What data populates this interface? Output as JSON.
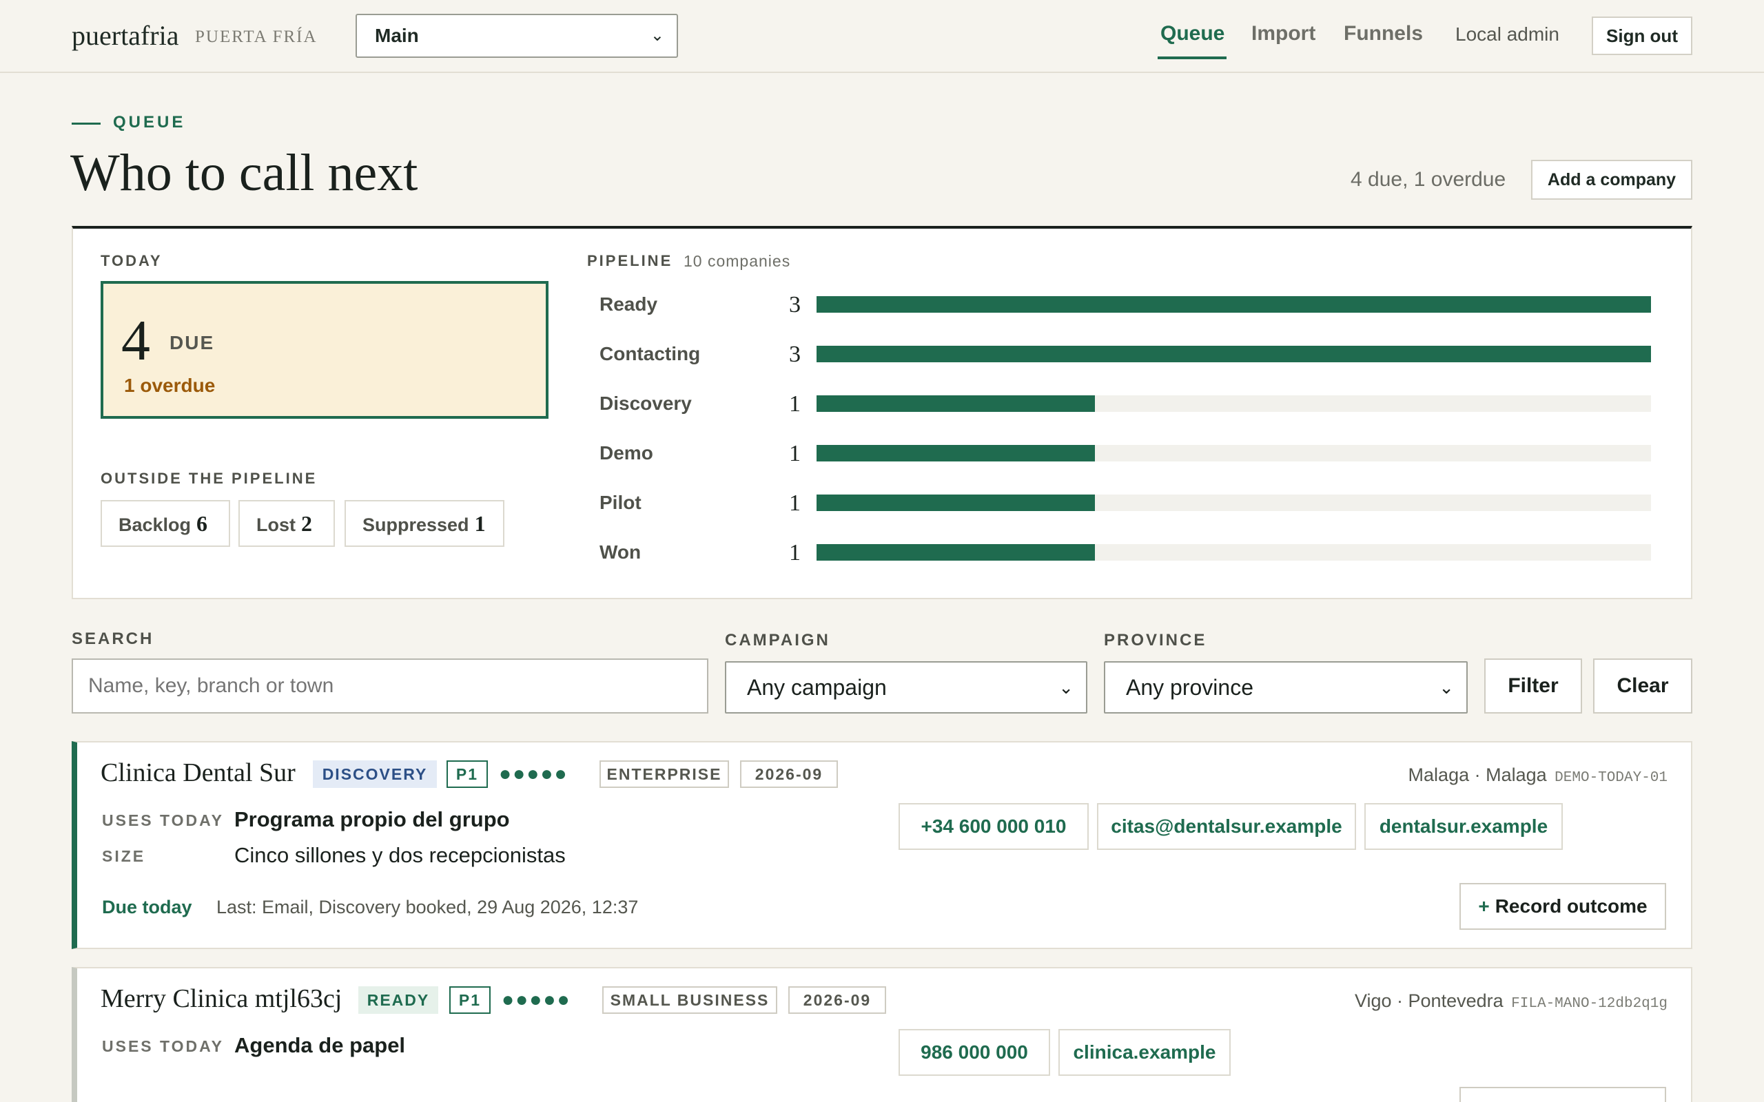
{
  "header": {
    "brand": "puertafria",
    "brand_sub": "PUERTA FRÍA",
    "workspace_select": "Main",
    "nav": [
      "Queue",
      "Import",
      "Funnels"
    ],
    "active_nav": "Queue",
    "user": "Local admin",
    "sign_out": "Sign out"
  },
  "page": {
    "eyebrow": "QUEUE",
    "title": "Who to call next",
    "summary": "4 due, 1 overdue",
    "add_button": "Add a company"
  },
  "today": {
    "label": "TODAY",
    "due_count": "4",
    "due_label": "DUE",
    "overdue": "1 overdue"
  },
  "outside": {
    "label": "OUTSIDE THE PIPELINE",
    "chips": [
      {
        "label": "Backlog",
        "count": "6"
      },
      {
        "label": "Lost",
        "count": "2"
      },
      {
        "label": "Suppressed",
        "count": "1"
      }
    ]
  },
  "pipeline": {
    "label": "PIPELINE",
    "count": "10 companies",
    "max": 3,
    "stages": [
      {
        "name": "Ready",
        "count": "3",
        "value": 3
      },
      {
        "name": "Contacting",
        "count": "3",
        "value": 3
      },
      {
        "name": "Discovery",
        "count": "1",
        "value": 1
      },
      {
        "name": "Demo",
        "count": "1",
        "value": 1
      },
      {
        "name": "Pilot",
        "count": "1",
        "value": 1
      },
      {
        "name": "Won",
        "count": "1",
        "value": 1
      }
    ]
  },
  "filters": {
    "search_label": "SEARCH",
    "search_placeholder": "Name, key, branch or town",
    "campaign_label": "CAMPAIGN",
    "campaign_value": "Any campaign",
    "province_label": "PROVINCE",
    "province_value": "Any province",
    "filter_button": "Filter",
    "clear_button": "Clear"
  },
  "companies": [
    {
      "name": "Clinica Dental Sur",
      "stage": "DISCOVERY",
      "priority": "P1",
      "score_dots": "●●●●●",
      "segment": "ENTERPRISE",
      "cohort": "2026-09",
      "location": "Malaga · Malaga",
      "key": "DEMO-TODAY-01",
      "uses_today_label": "USES TODAY",
      "uses_today": "Programa propio del grupo",
      "size_label": "SIZE",
      "size": "Cinco sillones y dos recepcionistas",
      "contacts": [
        "+34 600 000 010",
        "citas@dentalsur.example",
        "dentalsur.example"
      ],
      "due": "Due today",
      "last": "Last: Email, Discovery booked, 29 Aug 2026, 12:37",
      "action": "Record outcome",
      "action_icon": "+"
    },
    {
      "name": "Merry Clinica mtjl63cj",
      "stage": "READY",
      "priority": "P1",
      "score_dots": "●●●●●",
      "segment": "SMALL BUSINESS",
      "cohort": "2026-09",
      "location": "Vigo · Pontevedra",
      "key": "FILA-MANO-12db2q1g",
      "uses_today_label": "USES TODAY",
      "uses_today": "Agenda de papel",
      "contacts": [
        "986 000 000",
        "clinica.example"
      ]
    }
  ],
  "colors": {
    "accent": "#1f6b4f",
    "background": "#f6f4ee",
    "today_box": "#faf0d8",
    "overdue": "#9b5a0a",
    "discovery_tag": "#e4ebf6"
  }
}
